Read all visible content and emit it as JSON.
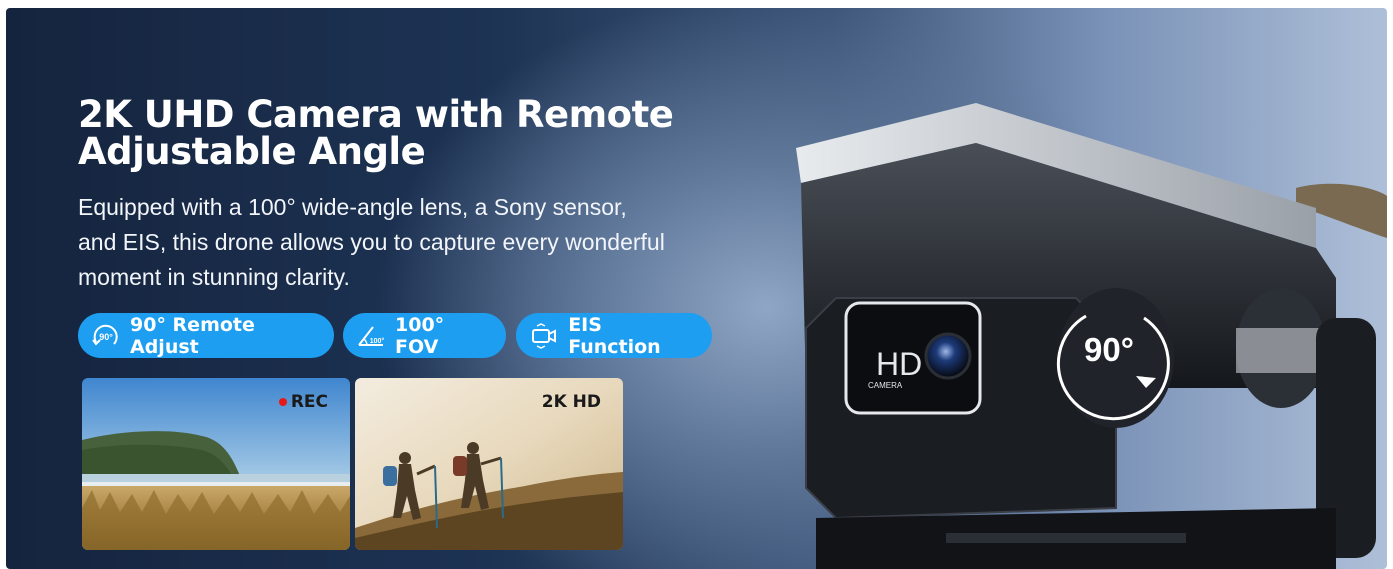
{
  "header": {
    "title_line1": "2K UHD Camera with Remote",
    "title_line2": "Adjustable Angle",
    "description_line1": "Equipped with a 100° wide-angle lens, a Sony sensor,",
    "description_line2": "and EIS, this drone allows you to capture every wonderful",
    "description_line3": "moment in stunning clarity."
  },
  "features": [
    {
      "label": "90° Remote Adjust",
      "icon": "rotate-90-icon",
      "icon_text": "90°"
    },
    {
      "label": "100° FOV",
      "icon": "angle-100-icon",
      "icon_text": "100°"
    },
    {
      "label": "EIS Function",
      "icon": "stabilized-camera-icon"
    }
  ],
  "photos": [
    {
      "name": "coast-landscape",
      "label": "REC"
    },
    {
      "name": "hikers",
      "label": "2K HD"
    }
  ],
  "drone": {
    "lens_label": "HD",
    "lens_sub": "CAMERA",
    "angle_badge": "90°"
  },
  "colors": {
    "accent": "#1e9ef0",
    "rec": "#e61919",
    "background_dark": "#15243e"
  }
}
